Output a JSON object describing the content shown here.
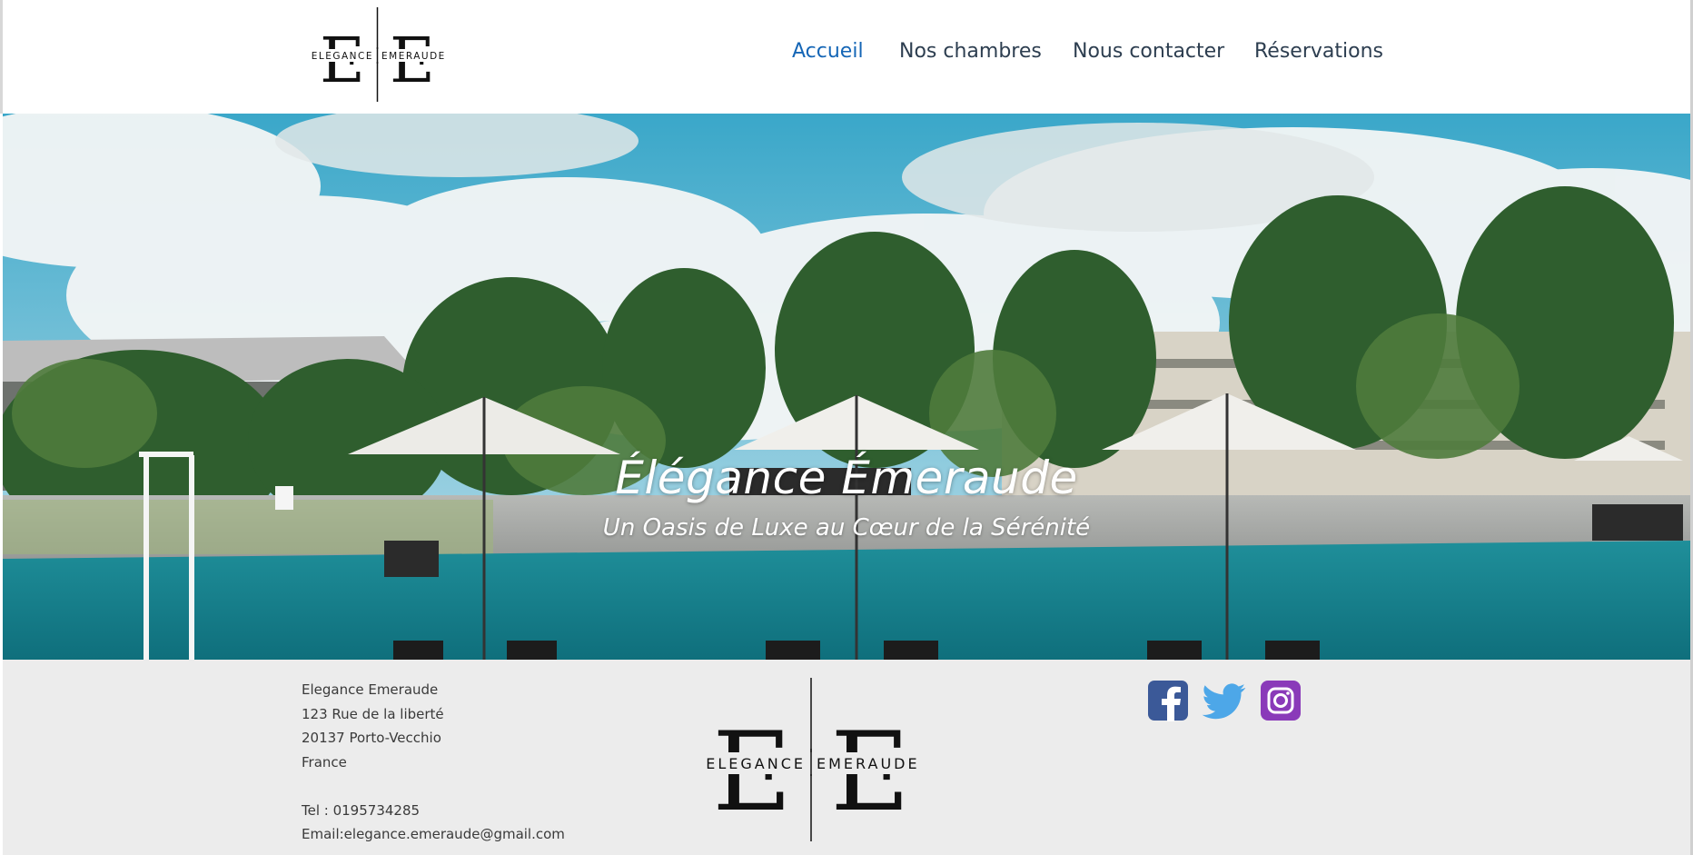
{
  "brand": {
    "logo_text_left": "ELEGANCE",
    "logo_text_right": "EMERAUDE"
  },
  "nav": {
    "items": [
      {
        "label": "Accueil",
        "active": true
      },
      {
        "label": "Nos chambres",
        "active": false
      },
      {
        "label": "Nous contacter",
        "active": false
      },
      {
        "label": "Réservations",
        "active": false
      }
    ]
  },
  "hero": {
    "title": "Élégance Émeraude",
    "subtitle": "Un Oasis de Luxe au Cœur de la Sérénité"
  },
  "footer": {
    "address": [
      "Elegance Emeraude",
      "123 Rue de la liberté",
      "20137 Porto-Vecchio",
      "France"
    ],
    "tel": "Tel : 0195734285",
    "email": "Email:elegance.emeraude@gmail.com",
    "social": [
      "facebook-icon",
      "twitter-icon",
      "instagram-icon"
    ]
  },
  "colors": {
    "nav_active": "#1566b6",
    "nav_text": "#2d3e50",
    "footer_bg": "#ececec",
    "facebook": "#3b5998",
    "twitter": "#4da7e8",
    "instagram": "#8a3ab9"
  }
}
